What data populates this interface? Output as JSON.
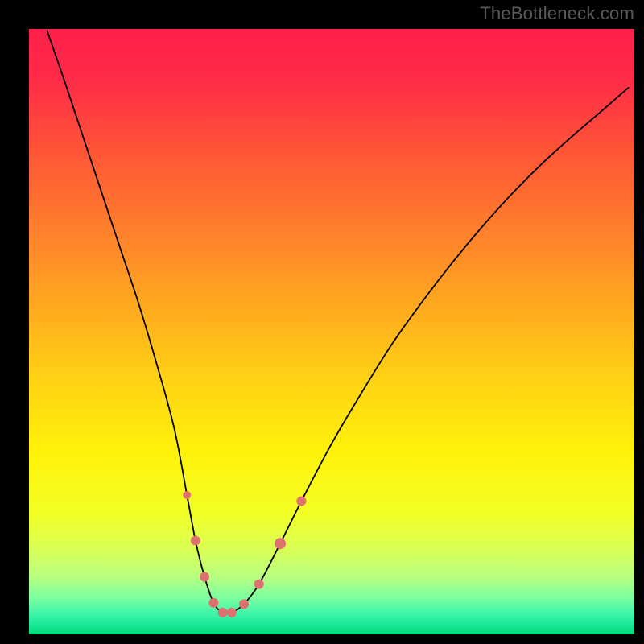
{
  "attribution": "TheBottleneck.com",
  "chart_data": {
    "type": "line",
    "title": "",
    "xlabel": "",
    "ylabel": "",
    "xlim": [
      0,
      100
    ],
    "ylim": [
      0,
      100
    ],
    "grid": false,
    "legend": false,
    "series": [
      {
        "name": "bottleneck-curve",
        "x": [
          3,
          6,
          9,
          12,
          15,
          18,
          21,
          24,
          26.1,
          27.5,
          29,
          30.5,
          32,
          33.5,
          35.5,
          38,
          41.5,
          45,
          50,
          55,
          60,
          65,
          70,
          75,
          80,
          85,
          90,
          95,
          99
        ],
        "y": [
          99.7,
          91,
          82,
          73,
          64,
          55,
          45,
          34,
          23,
          15.5,
          9.5,
          5.2,
          3.6,
          3.6,
          5,
          8.3,
          15,
          22,
          31.5,
          40,
          48,
          55,
          61.5,
          67.5,
          73,
          78,
          82.5,
          86.8,
          90.3
        ],
        "stroke": "#000000",
        "stroke_width": 1.8
      }
    ],
    "markers": {
      "name": "dip-markers",
      "points": [
        {
          "x": 26.1,
          "y": 23.0,
          "r": 5
        },
        {
          "x": 27.5,
          "y": 15.5,
          "r": 6
        },
        {
          "x": 29.0,
          "y": 9.5,
          "r": 6
        },
        {
          "x": 30.5,
          "y": 5.2,
          "r": 6
        },
        {
          "x": 32.0,
          "y": 3.6,
          "r": 6
        },
        {
          "x": 33.5,
          "y": 3.6,
          "r": 6
        },
        {
          "x": 35.5,
          "y": 5.0,
          "r": 6
        },
        {
          "x": 38.0,
          "y": 8.3,
          "r": 6
        },
        {
          "x": 41.5,
          "y": 15.0,
          "r": 7
        },
        {
          "x": 45.0,
          "y": 22.0,
          "r": 6
        }
      ],
      "fill": "#e07070"
    },
    "background_gradient": {
      "stops": [
        {
          "offset": 0.0,
          "color": "#ff1f4b"
        },
        {
          "offset": 0.08,
          "color": "#ff2a48"
        },
        {
          "offset": 0.2,
          "color": "#ff5436"
        },
        {
          "offset": 0.33,
          "color": "#ff7e2c"
        },
        {
          "offset": 0.46,
          "color": "#ffaa1e"
        },
        {
          "offset": 0.58,
          "color": "#ffd214"
        },
        {
          "offset": 0.7,
          "color": "#fff20a"
        },
        {
          "offset": 0.8,
          "color": "#f2ff25"
        },
        {
          "offset": 0.86,
          "color": "#d9ff55"
        },
        {
          "offset": 0.905,
          "color": "#b8ff80"
        },
        {
          "offset": 0.94,
          "color": "#7cffa0"
        },
        {
          "offset": 0.965,
          "color": "#40f5a8"
        },
        {
          "offset": 0.985,
          "color": "#18e898"
        },
        {
          "offset": 1.0,
          "color": "#00d878"
        }
      ]
    }
  }
}
